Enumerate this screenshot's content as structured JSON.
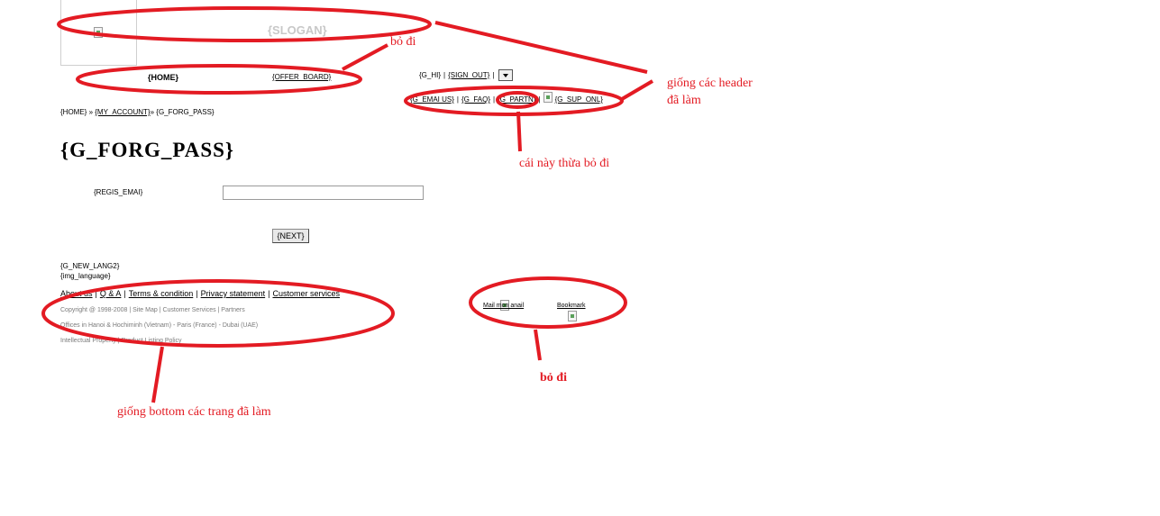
{
  "header": {
    "slogan": "{SLOGAN}",
    "nav": {
      "home": "{HOME}",
      "offer_board": "{OFFER_BOARD}"
    },
    "user": {
      "hi": "{G_HI}",
      "sign_out": "{SIGN_OUT}"
    },
    "links": {
      "email_us": "{G_EMAI US}",
      "faq": "{G_FAQ}",
      "partn": "{G_PARTN}",
      "sup_onl": "{G_SUP_ONL}"
    }
  },
  "breadcrumb": {
    "home": "{HOME}",
    "sep1": " » ",
    "my_account": "{MY_ACCOUNT}",
    "sep2": "» ",
    "current": "{G_FORG_PASS}"
  },
  "page": {
    "title": "{G_FORG_PASS}"
  },
  "form": {
    "email_label": "{REGIS_EMAI}",
    "email_value": "",
    "next_button": "{NEXT}"
  },
  "lang": {
    "new_lang2": "{G_NEW_LANG2}",
    "img_language": "{img_language}"
  },
  "footer": {
    "links": [
      "About us",
      "Q & A",
      "Terms & condition",
      "Privacy statement",
      "Customer services"
    ],
    "copyright": "Copyright @ 1998-2008 | Site Map | Customer Services | Partners",
    "offices": "Offices in Hanoi & Hochiminh (Vietnam) - Paris (France) - Dubai (UAE)",
    "policy": "Intellectual Property | Product Listing Policy"
  },
  "side_links": {
    "mail": "Mail mon anail",
    "bookmark": "Bookmark"
  },
  "annotations": {
    "remove_top": "bỏ đi",
    "same_header": [
      "giống các header",
      "đã làm"
    ],
    "redundant": "cái này thừa bỏ đi",
    "remove_bottom": "bỏ đi",
    "same_bottom": "giống bottom các trang đã làm"
  },
  "colors": {
    "annotation": "#e31b23",
    "slogan": "#c8c8c8",
    "footer_text": "#7a7a7a"
  }
}
